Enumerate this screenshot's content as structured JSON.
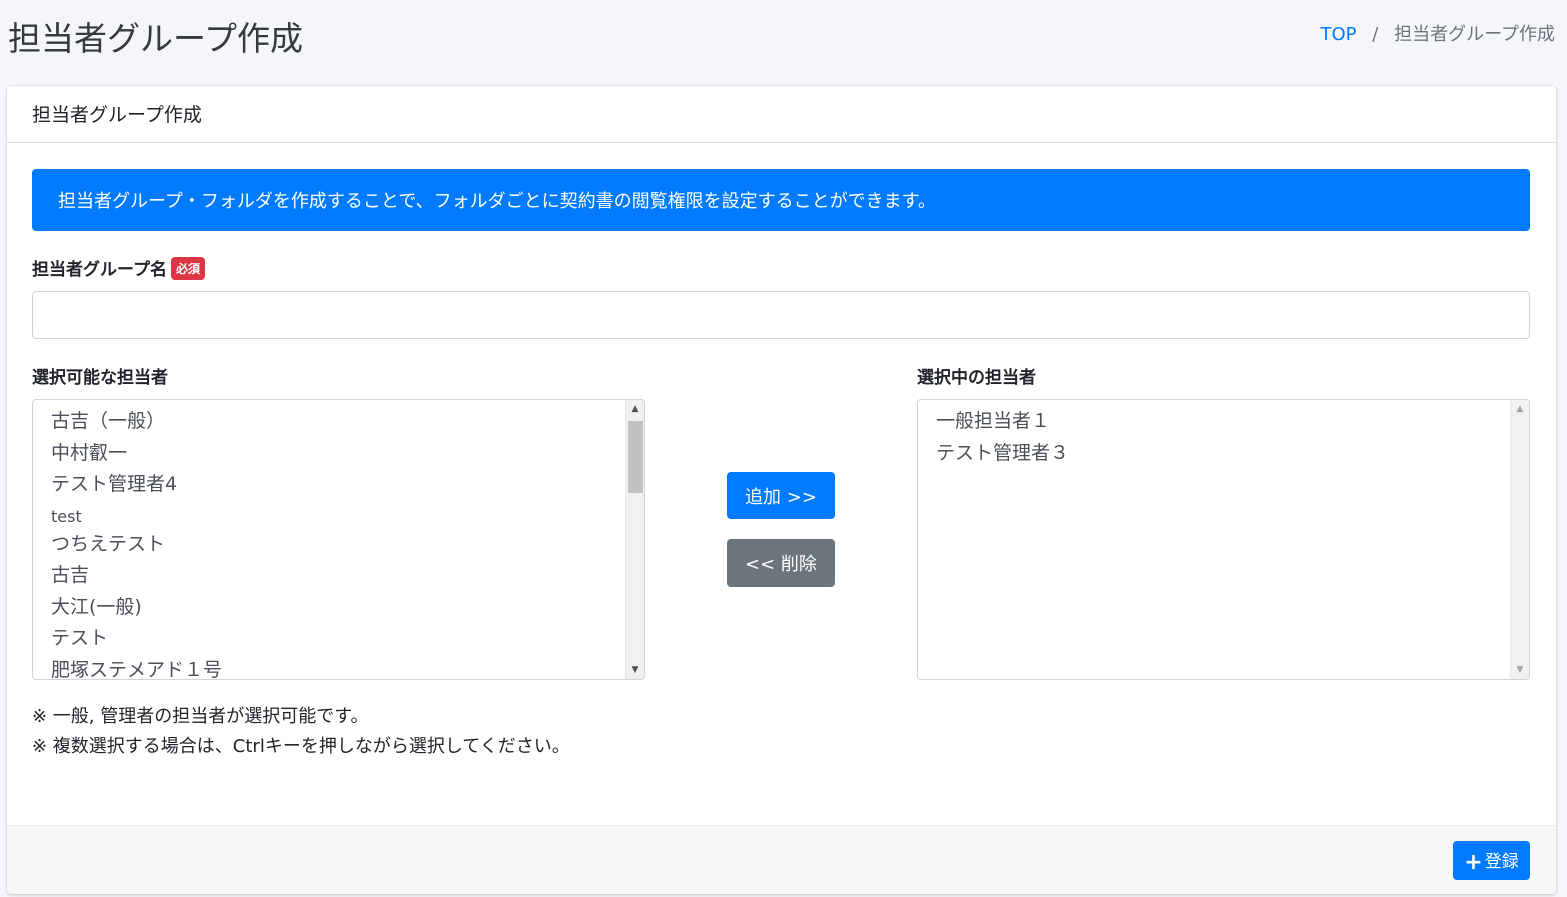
{
  "page": {
    "title": "担当者グループ作成"
  },
  "breadcrumb": {
    "items": [
      "TOP",
      "担当者グループ作成"
    ],
    "separator": "/"
  },
  "card": {
    "header": "担当者グループ作成",
    "info_message": "担当者グループ・フォルダを作成することで、フォルダごとに契約書の閲覧権限を設定することができます。"
  },
  "form": {
    "group_name_label": "担当者グループ名",
    "required_badge": "必須",
    "group_name_value": "",
    "available_label": "選択可能な担当者",
    "selected_label": "選択中の担当者",
    "available_users": [
      "古吉（一般）",
      "中村叡一",
      "テスト管理者4",
      "test",
      "つちえテスト",
      "古吉",
      "大江(一般)",
      "テスト",
      "肥塚ステメアド１号"
    ],
    "selected_users": [
      "一般担当者１",
      "テスト管理者３"
    ],
    "add_button": "追加 >>",
    "remove_button": "<< 削除",
    "notes": [
      "※ 一般, 管理者の担当者が選択可能です。",
      "※ 複数選択する場合は、Ctrlキーを押しながら選択してください。"
    ]
  },
  "footer": {
    "register_button": "登録",
    "register_icon": "plus-icon"
  },
  "colors": {
    "primary": "#007bff",
    "secondary": "#6c757d",
    "danger": "#dc3545"
  }
}
